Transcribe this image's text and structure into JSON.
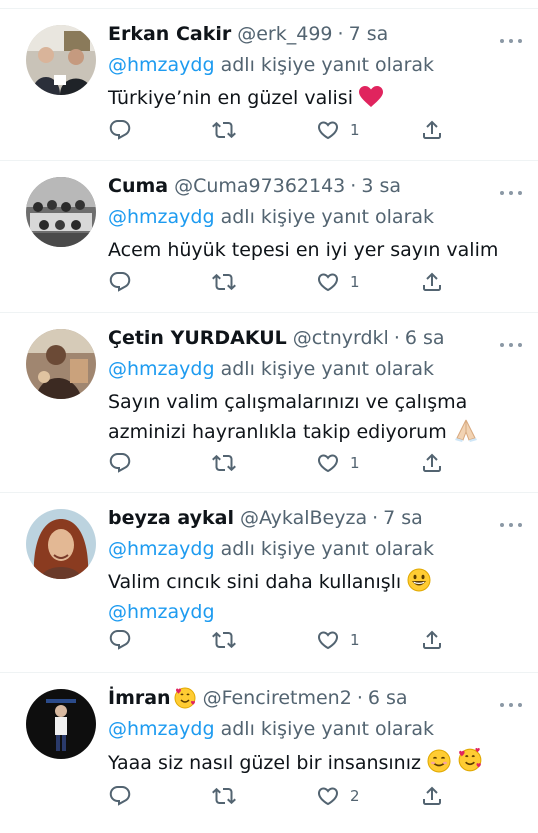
{
  "tweets": [
    {
      "name": "Erkan Cakir",
      "handle": "@erk_499",
      "time": "7 sa",
      "reply_to": "@hmzaydg",
      "reply_suffix": "adlı kişiye yanıt olarak",
      "text": "Türkiye’nin en güzel valisi",
      "like_count": "1"
    },
    {
      "name": "Cuma",
      "handle": "@Cuma97362143",
      "time": "3 sa",
      "reply_to": "@hmzaydg",
      "reply_suffix": "adlı kişiye yanıt olarak",
      "text": "Acem hüyük tepesi en iyi yer sayın valim",
      "like_count": "1"
    },
    {
      "name": "Çetin YURDAKUL",
      "handle": "@ctnyrdkl",
      "time": "6 sa",
      "reply_to": "@hmzaydg",
      "reply_suffix": "adlı kişiye yanıt olarak",
      "text_line1": "Sayın valim çalışmalarınızı ve çalışma",
      "text_line2": "azminizi hayranlıkla takip ediyorum",
      "like_count": "1"
    },
    {
      "name": "beyza aykal",
      "handle": "@AykalBeyza",
      "time": "7 sa",
      "reply_to": "@hmzaydg",
      "reply_suffix": "adlı kişiye yanıt olarak",
      "text": "Valim cıncık sini daha kullanışlı",
      "text_mention": "@hmzaydg",
      "like_count": "1"
    },
    {
      "name": "İmran",
      "handle": "@Fenciretmen2",
      "time": "6 sa",
      "reply_to": "@hmzaydg",
      "reply_suffix": "adlı kişiye yanıt olarak",
      "text": "Yaaa siz nasıl güzel bir insansınız",
      "like_count": "2"
    }
  ],
  "separator": "·",
  "icons": {
    "reply": "reply-icon",
    "retweet": "retweet-icon",
    "like": "heart-icon",
    "share": "share-icon",
    "more": "more-icon"
  },
  "colors": {
    "mention": "#1d9bf0",
    "secondary_text": "#536471",
    "divider": "#eff3f4",
    "heart_emoji": "#e0245e"
  }
}
